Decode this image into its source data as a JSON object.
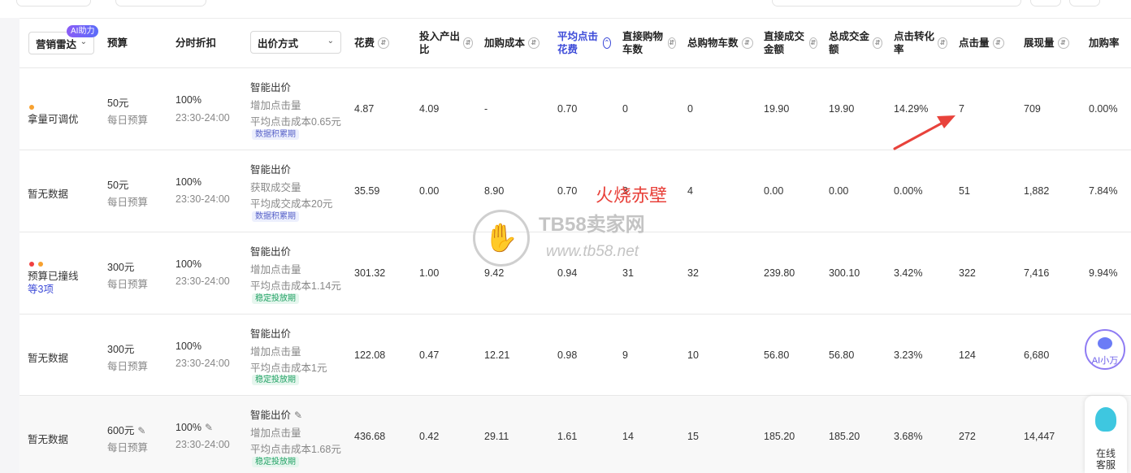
{
  "header": {
    "marketing_radar": "营销雷达",
    "ai_badge": "AI助力",
    "budget": "预算",
    "timeslot_discount": "分时折扣",
    "bid_method": "出价方式",
    "cost": "花费",
    "roi": "投入产出比",
    "add_cart_cost": "加购成本",
    "avg_click_cost": "平均点击花费",
    "direct_cart": "直接购物车数",
    "total_cart": "总购物车数",
    "direct_gmv": "直接成交金额",
    "total_gmv": "总成交金额",
    "ctr_conv": "点击转化率",
    "clicks": "点击量",
    "impressions": "展现量",
    "add_cart_rate": "加购率"
  },
  "rows": [
    {
      "radar": "拿量可调优",
      "radar_more": "",
      "budget": "50元",
      "budget_sub": "每日预算",
      "discount": "100%",
      "discount_time": "23:30-24:00",
      "bid_title": "智能出价",
      "bid_goal": "增加点击量",
      "bid_target": "平均点击成本0.65元",
      "tag": "数据积累期",
      "cost": "4.87",
      "roi": "4.09",
      "add_cart_cost": "-",
      "avg_click": "0.70",
      "direct_cart": "0",
      "total_cart": "0",
      "direct_gmv": "19.90",
      "total_gmv": "19.90",
      "conv": "14.29%",
      "clicks": "7",
      "impressions": "709",
      "cart_rate": "0.00%"
    },
    {
      "radar": "暂无数据",
      "radar_more": "",
      "budget": "50元",
      "budget_sub": "每日预算",
      "discount": "100%",
      "discount_time": "23:30-24:00",
      "bid_title": "智能出价",
      "bid_goal": "获取成交量",
      "bid_target": "平均成交成本20元",
      "tag": "数据积累期",
      "cost": "35.59",
      "roi": "0.00",
      "add_cart_cost": "8.90",
      "avg_click": "0.70",
      "direct_cart": "3",
      "total_cart": "4",
      "direct_gmv": "0.00",
      "total_gmv": "0.00",
      "conv": "0.00%",
      "clicks": "51",
      "impressions": "1,882",
      "cart_rate": "7.84%"
    },
    {
      "radar": "预算已撞线",
      "radar_more": "等3项",
      "budget": "300元",
      "budget_sub": "每日预算",
      "discount": "100%",
      "discount_time": "23:30-24:00",
      "bid_title": "智能出价",
      "bid_goal": "增加点击量",
      "bid_target": "平均点击成本1.14元",
      "tag": "稳定投放期",
      "cost": "301.32",
      "roi": "1.00",
      "add_cart_cost": "9.42",
      "avg_click": "0.94",
      "direct_cart": "31",
      "total_cart": "32",
      "direct_gmv": "239.80",
      "total_gmv": "300.10",
      "conv": "3.42%",
      "clicks": "322",
      "impressions": "7,416",
      "cart_rate": "9.94%"
    },
    {
      "radar": "暂无数据",
      "radar_more": "",
      "budget": "300元",
      "budget_sub": "每日预算",
      "discount": "100%",
      "discount_time": "23:30-24:00",
      "bid_title": "智能出价",
      "bid_goal": "增加点击量",
      "bid_target": "平均点击成本1元",
      "tag": "稳定投放期",
      "cost": "122.08",
      "roi": "0.47",
      "add_cart_cost": "12.21",
      "avg_click": "0.98",
      "direct_cart": "9",
      "total_cart": "10",
      "direct_gmv": "56.80",
      "total_gmv": "56.80",
      "conv": "3.23%",
      "clicks": "124",
      "impressions": "6,680",
      "cart_rate": ""
    },
    {
      "radar": "暂无数据",
      "radar_more": "",
      "budget": "600元",
      "budget_sub": "每日预算",
      "discount": "100%",
      "discount_time": "23:30-24:00",
      "bid_title": "智能出价",
      "bid_goal": "增加点击量",
      "bid_target": "平均点击成本1.68元",
      "tag": "稳定投放期",
      "cost": "436.68",
      "roi": "0.42",
      "add_cart_cost": "29.11",
      "avg_click": "1.61",
      "direct_cart": "14",
      "total_cart": "15",
      "direct_gmv": "185.20",
      "total_gmv": "185.20",
      "conv": "3.68%",
      "clicks": "272",
      "impressions": "14,447",
      "cart_rate": ""
    }
  ],
  "watermark": {
    "red_text": "火烧赤壁",
    "brand": "TB58卖家网",
    "url": "www.tb58.net"
  },
  "floating": {
    "ai_label": "AI小万",
    "cs_label_1": "在线",
    "cs_label_2": "客服"
  },
  "colors": {
    "accent": "#3d4bd8",
    "tag_blue": "#5a64c9",
    "tag_green": "#23a265",
    "dot_red": "#f04040",
    "dot_orange": "#f7a130",
    "annotation": "#e8423b"
  }
}
